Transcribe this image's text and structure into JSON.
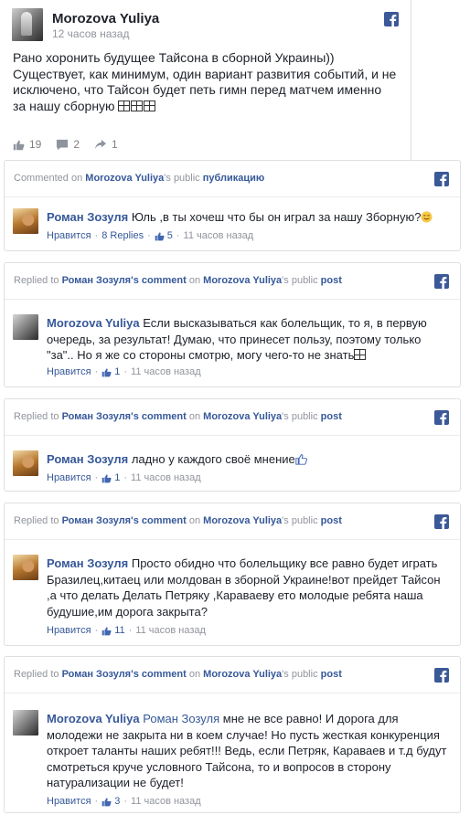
{
  "post": {
    "author": "Morozova Yuliya",
    "time": "12 часов назад",
    "text": "Рано хоронить будущее Тайсона в сборной Украины)) Существует, как минимум, один вариант развития событий, и не исключено, что Тайсон будет петь гимн перед матчем именно за нашу сборную",
    "likes": "19",
    "comments": "2",
    "shares": "1"
  },
  "cards": [
    {
      "header": {
        "prefix": "Commented on",
        "target": "Morozova Yuliya",
        "mid": "'s public",
        "object": "публикацию"
      },
      "author": "Роман Зозуля",
      "text": "Юль ,в ты хочеш что бы он играл за нашу Зборную?",
      "like_label": "Нравится",
      "replies": "8 Replies",
      "likes": "5",
      "time": "11 часов назад"
    },
    {
      "header": {
        "prefix": "Replied to",
        "target": "Роман Зозуля's comment",
        "mid": "on",
        "target2": "Morozova Yuliya",
        "mid2": "'s public",
        "object": "post"
      },
      "author": "Morozova Yuliya",
      "text": "Если высказываться как болельщик, то я, в первую очередь, за результат! Думаю, что принесет пользу, поэтому только \"за\".. Но я же со стороны смотрю, могу чего-то не знать",
      "like_label": "Нравится",
      "likes": "1",
      "time": "11 часов назад"
    },
    {
      "header": {
        "prefix": "Replied to",
        "target": "Роман Зозуля's comment",
        "mid": "on",
        "target2": "Morozova Yuliya",
        "mid2": "'s public",
        "object": "post"
      },
      "author": "Роман Зозуля",
      "text": "ладно у каждого своё мнение",
      "like_label": "Нравится",
      "likes": "1",
      "time": "11 часов назад"
    },
    {
      "header": {
        "prefix": "Replied to",
        "target": "Роман Зозуля's comment",
        "mid": "on",
        "target2": "Morozova Yuliya",
        "mid2": "'s public",
        "object": "post"
      },
      "author": "Роман Зозуля",
      "text": "Просто обидно что болельщику все равно будет играть Бразилец,китаец или молдован в зборной Украине!вот прейдет Тайсон ,а что делать Делать Петряку ,Караваеву ето молодые ребята наша будушие,им дорога закрыта?",
      "like_label": "Нравится",
      "likes": "11",
      "time": "11 часов назад"
    },
    {
      "header": {
        "prefix": "Replied to",
        "target": "Роман Зозуля's comment",
        "mid": "on",
        "target2": "Morozova Yuliya",
        "mid2": "'s public",
        "object": "post"
      },
      "author": "Morozova Yuliya",
      "mention": "Роман Зозуля",
      "text": "мне не все равно! И дорога для молодежи не закрыта ни в коем случае! Но пусть жесткая конкуренция откроет таланты наших ребят!!! Ведь, если Петряк, Караваев и т.д будут смотреться круче условного Тайсона, то и вопросов в сторону натурализации не будет!",
      "like_label": "Нравится",
      "likes": "3",
      "time": "11 часов назад"
    }
  ],
  "colors": {
    "link": "#365899",
    "meta": "#90949c",
    "facebook": "#3b5998",
    "text": "#1d2129"
  },
  "icons": [
    "facebook-icon",
    "thumbs-up-icon",
    "comment-icon",
    "share-icon",
    "like-small-icon"
  ]
}
